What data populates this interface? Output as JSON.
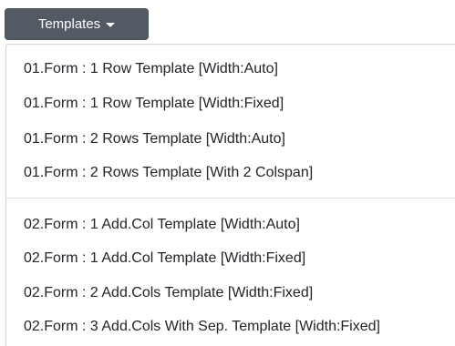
{
  "dropdown": {
    "button_label": "Templates",
    "caret_icon": "caret-down-icon",
    "button_color": "#525a63",
    "groups": [
      {
        "items": [
          {
            "label": "01.Form : 1 Row Template [Width:Auto]"
          },
          {
            "label": "01.Form : 1 Row Template [Width:Fixed]"
          },
          {
            "label": "01.Form : 2 Rows Template [Width:Auto]"
          },
          {
            "label": "01.Form : 2 Rows Template [With 2 Colspan]"
          }
        ]
      },
      {
        "items": [
          {
            "label": "02.Form : 1 Add.Col Template [Width:Auto]"
          },
          {
            "label": "02.Form : 1 Add.Col Template [Width:Fixed]"
          },
          {
            "label": "02.Form : 2 Add.Cols Template [Width:Fixed]"
          },
          {
            "label": "02.Form : 3 Add.Cols With Sep. Template [Width:Fixed]"
          }
        ]
      }
    ]
  }
}
